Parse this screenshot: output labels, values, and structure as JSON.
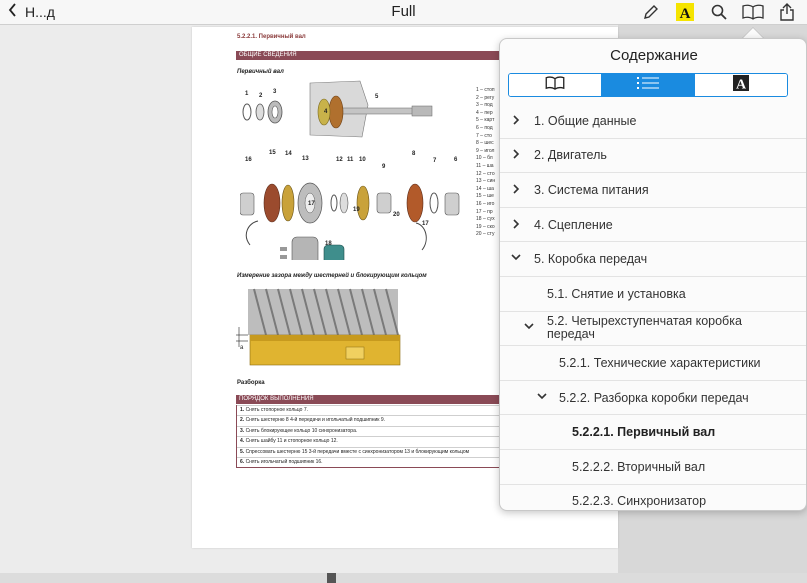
{
  "toolbar": {
    "back_label": "Н...д",
    "title": "Full",
    "icons": [
      "chevron-left-icon",
      "pencil-icon",
      "highlight-icon",
      "search-icon",
      "book-icon",
      "share-icon"
    ]
  },
  "page": {
    "section_title": "5.2.2.1. Первичный вал",
    "band_general": "ОБЩИЕ СВЕДЕНИЯ",
    "shaft_label": "Первичный вал",
    "legend": [
      "1 – стоп",
      "2 – регу",
      "3 – под",
      "4 – пер",
      "5 – карт",
      "6 – под",
      "7 – сто",
      "8 – шес",
      "9 – игол",
      "10 – бл",
      "11 – ша",
      "12 – сто",
      "13 – син",
      "14 – ша",
      "15 – ше",
      "16 – иго",
      "17 – пр",
      "18 – сух",
      "19 – ско",
      "20 – сту"
    ],
    "part_numbers": [
      "1",
      "2",
      "3",
      "4",
      "5",
      "16",
      "15",
      "14",
      "13",
      "12",
      "11",
      "10",
      "9",
      "8",
      "7",
      "6",
      "17",
      "18",
      "19",
      "20",
      "17"
    ],
    "gap_label": "Измерение зазора между шестерней и блокирующим кольцом",
    "gap_marker": "a",
    "disassembly_label": "Разборка",
    "band_procedure": "ПОРЯДОК ВЫПОЛНЕНИЯ",
    "steps": [
      {
        "num": "1.",
        "text": "Снять стопорное кольцо 7."
      },
      {
        "num": "2.",
        "text": "Снять шестерню 8 4-й передачи и игольчатый подшипник 9."
      },
      {
        "num": "3.",
        "text": "Снять блокирующее кольцо 10 синхронизатора."
      },
      {
        "num": "4.",
        "text": "Снять шайбу 11 и стопорное кольцо 12."
      },
      {
        "num": "5.",
        "text": "Спрессовать шестерню 15 3-й передачи вместе с синхронизатором 13 и блокирующим кольцом"
      },
      {
        "num": "6.",
        "text": "Снять игольчатый подшипник 16."
      }
    ]
  },
  "toc": {
    "title": "Содержание",
    "tabs": [
      {
        "name": "book-icon",
        "active": false
      },
      {
        "name": "list-icon",
        "active": true
      },
      {
        "name": "font-icon",
        "active": false
      }
    ],
    "items": [
      {
        "label": "1. Общие данные",
        "level": 0,
        "disclosure": "collapsed"
      },
      {
        "label": "2. Двигатель",
        "level": 0,
        "disclosure": "collapsed"
      },
      {
        "label": "3. Система питания",
        "level": 0,
        "disclosure": "collapsed"
      },
      {
        "label": "4. Сцепление",
        "level": 0,
        "disclosure": "collapsed"
      },
      {
        "label": "5. Коробка передач",
        "level": 0,
        "disclosure": "expanded"
      },
      {
        "label": "5.1. Снятие и установка",
        "level": 1,
        "disclosure": "none"
      },
      {
        "label": "5.2. Четырехступенчатая коробка передач",
        "level": 1,
        "disclosure": "expanded"
      },
      {
        "label": "5.2.1. Технические характеристики",
        "level": 2,
        "disclosure": "none"
      },
      {
        "label": "5.2.2. Разборка коробки передач",
        "level": 2,
        "disclosure": "expanded"
      },
      {
        "label": "5.2.2.1. Первичный вал",
        "level": 3,
        "disclosure": "none",
        "current": true
      },
      {
        "label": "5.2.2.2. Вторичный вал",
        "level": 3,
        "disclosure": "none"
      },
      {
        "label": "5.2.2.3. Синхронизатор",
        "level": 3,
        "disclosure": "none"
      }
    ]
  },
  "colors": {
    "accent": "#1a8be0",
    "highlight_yellow": "#f5e400",
    "band": "#8a4a56"
  }
}
